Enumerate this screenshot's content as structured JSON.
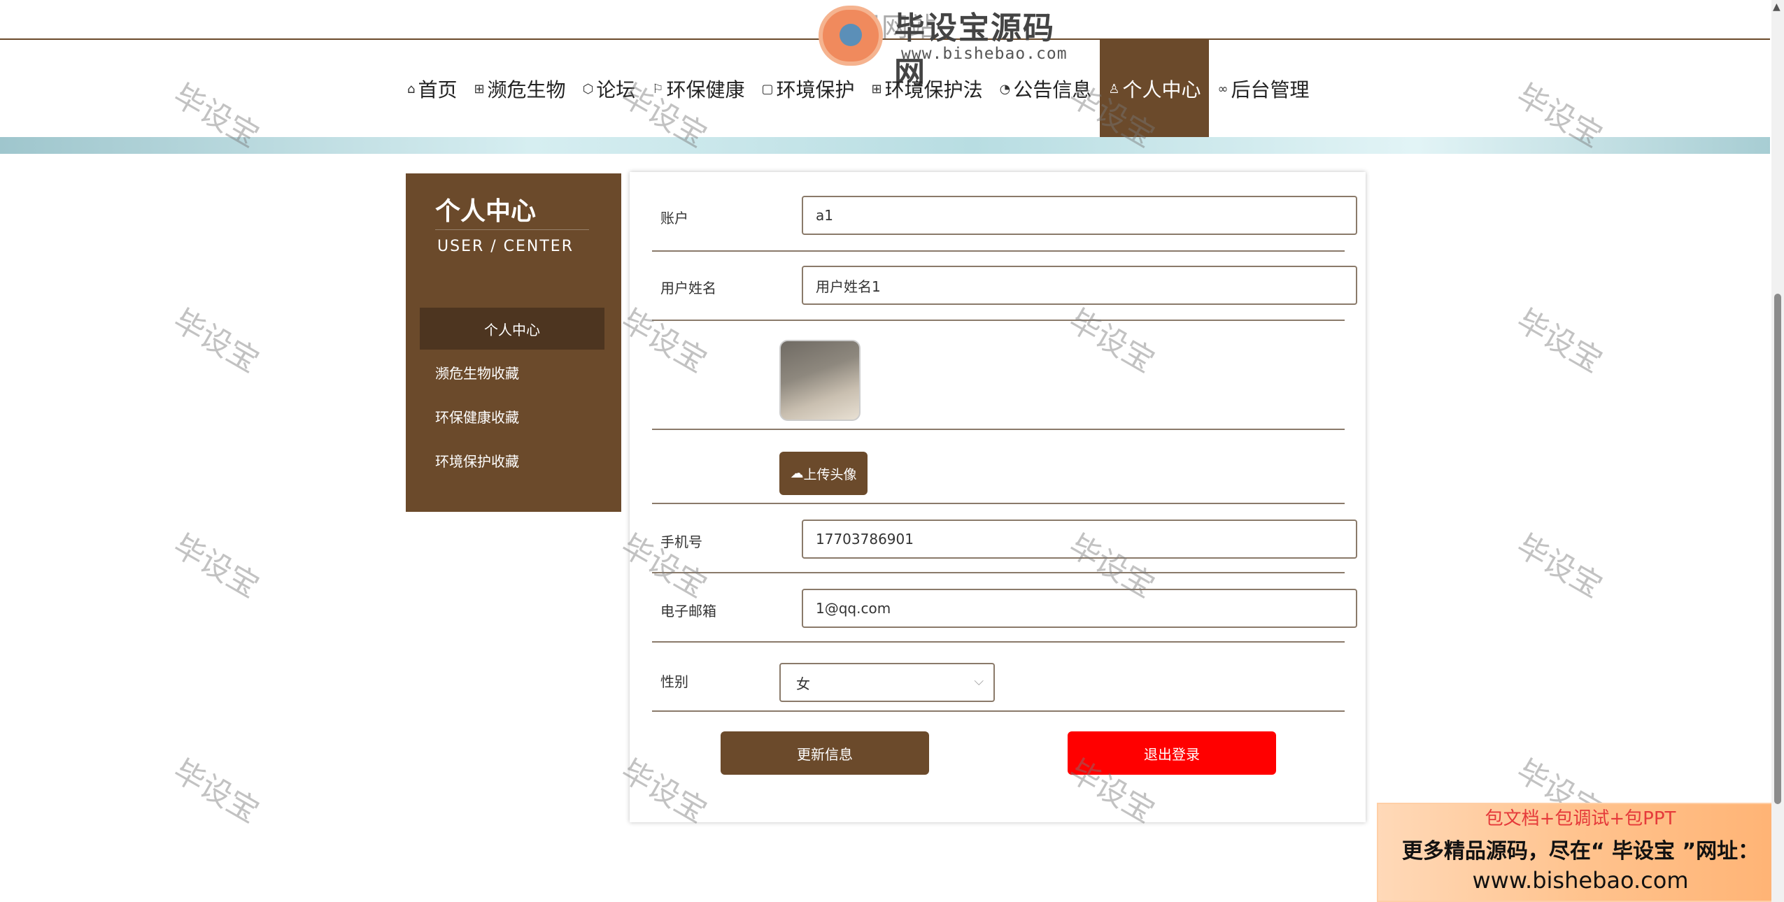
{
  "header": {
    "site_title": "环保网站",
    "logo_title": "毕设宝源码网",
    "logo_url": "www.bishebao.com"
  },
  "nav": [
    {
      "label": "首页",
      "icon": "home-icon",
      "glyph": "⌂"
    },
    {
      "label": "濒危生物",
      "icon": "grid-icon",
      "glyph": "⊞"
    },
    {
      "label": "论坛",
      "icon": "cube-icon",
      "glyph": "⬡"
    },
    {
      "label": "环保健康",
      "icon": "flag-icon",
      "glyph": "⚐"
    },
    {
      "label": "环境保护",
      "icon": "file-icon",
      "glyph": "▢"
    },
    {
      "label": "环境保护法",
      "icon": "apps-icon",
      "glyph": "⊞"
    },
    {
      "label": "公告信息",
      "icon": "palette-icon",
      "glyph": "◔"
    },
    {
      "label": "个人中心",
      "icon": "user-icon",
      "glyph": "♙"
    },
    {
      "label": "后台管理",
      "icon": "link-icon",
      "glyph": "∞"
    }
  ],
  "sidebar": {
    "title": "个人中心",
    "subtitle": "USER / CENTER",
    "items": [
      {
        "label": "个人中心"
      },
      {
        "label": "濒危生物收藏"
      },
      {
        "label": "环保健康收藏"
      },
      {
        "label": "环境保护收藏"
      }
    ]
  },
  "form": {
    "account_label": "账户",
    "account_value": "a1",
    "name_label": "用户姓名",
    "name_value": "用户姓名1",
    "upload_label": "上传头像",
    "phone_label": "手机号",
    "phone_value": "17703786901",
    "email_label": "电子邮箱",
    "email_value": "1@qq.com",
    "gender_label": "性别",
    "gender_value": "女",
    "update_button": "更新信息",
    "logout_button": "退出登录"
  },
  "watermark": "毕设宝",
  "ad": {
    "line1": "包文档+包调试+包PPT",
    "line2": "更多精品源码，尽在“ 毕设宝 ”网址：",
    "line3": "www.bishebao.com"
  },
  "colors": {
    "brand_brown": "#6b4a2b",
    "sidebar_active": "#4d3520",
    "logout_red": "#ff0000"
  }
}
